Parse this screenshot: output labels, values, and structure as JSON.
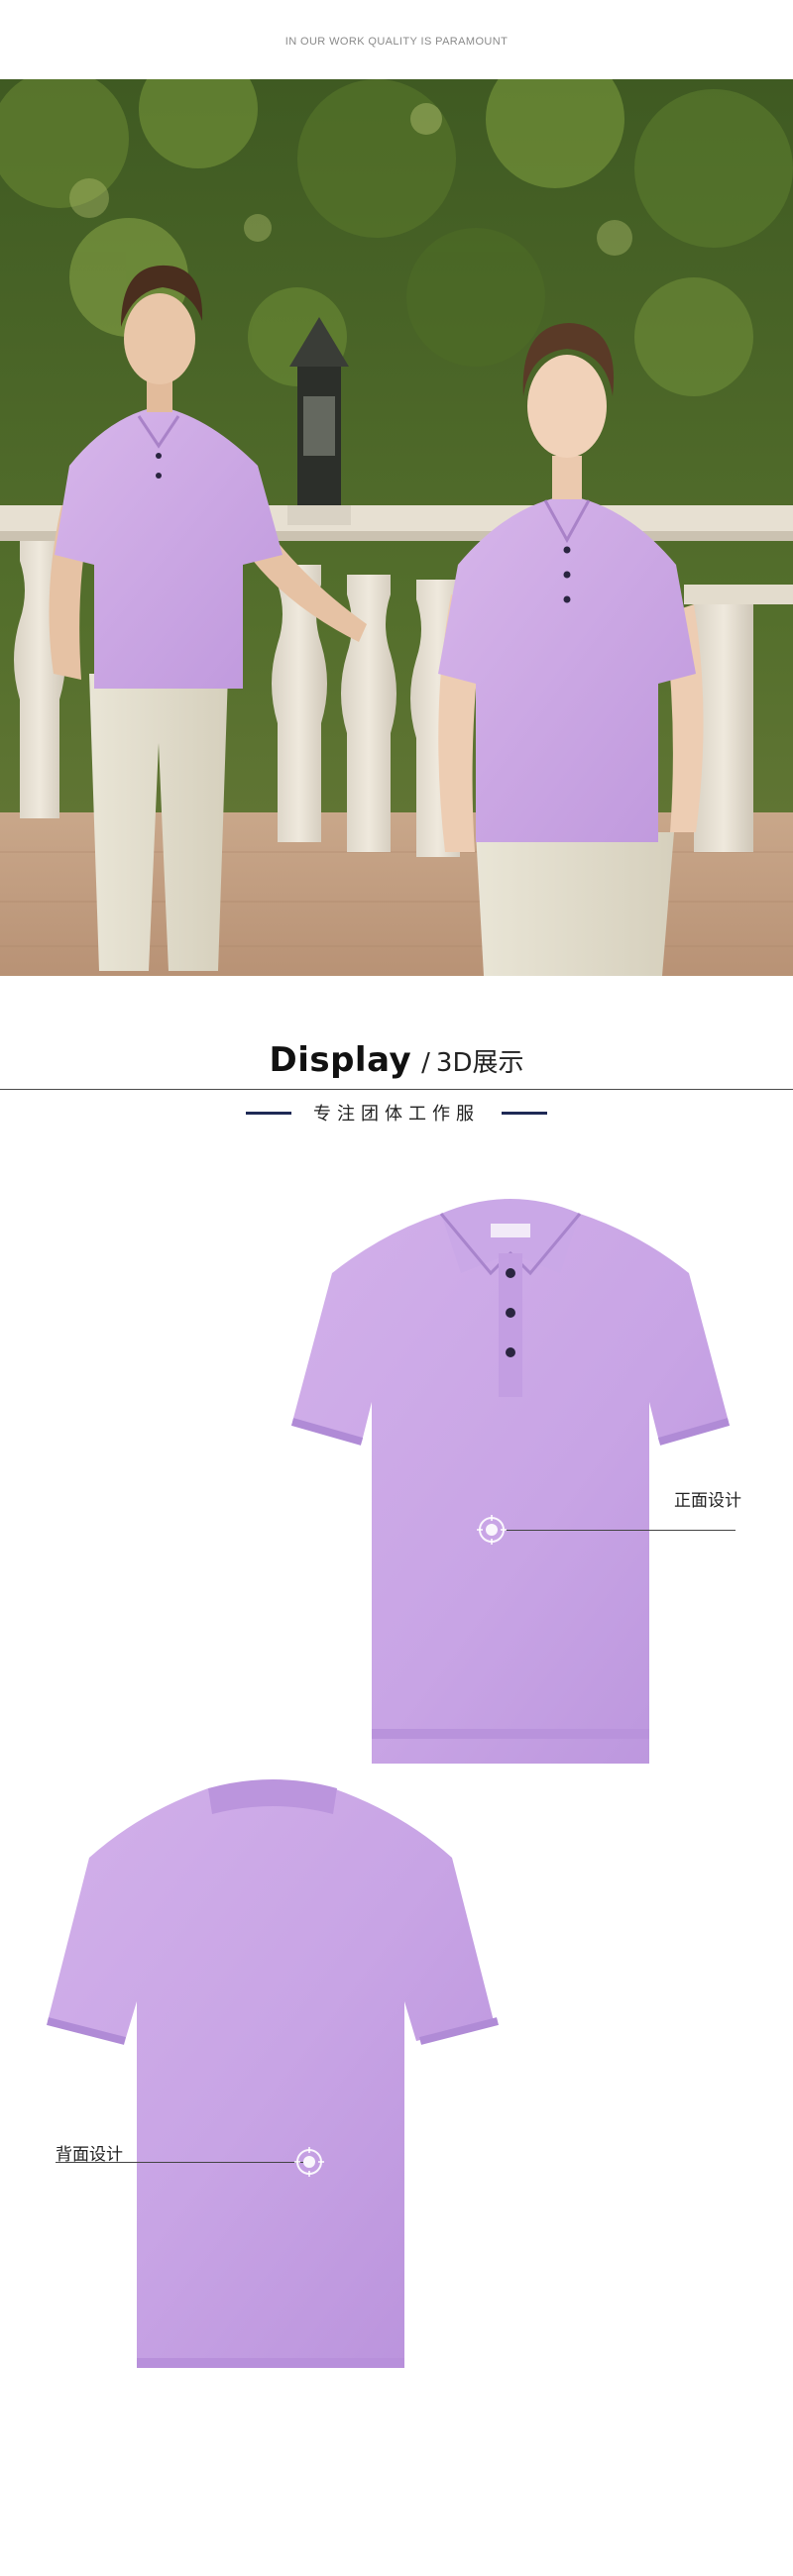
{
  "tagline": "IN OUR WORK QUALITY IS PARAMOUNT",
  "display": {
    "title": "Display",
    "slash": "/",
    "subtitle": "3D展示",
    "tagline_cn": "专注团体工作服"
  },
  "callouts": {
    "front": "正面设计",
    "back": "背面设计"
  },
  "colors": {
    "shirt": "#c9a6e6",
    "shirt_shadow": "#b990db",
    "accent_dash": "#1e2a55",
    "button": "#2a2540"
  }
}
